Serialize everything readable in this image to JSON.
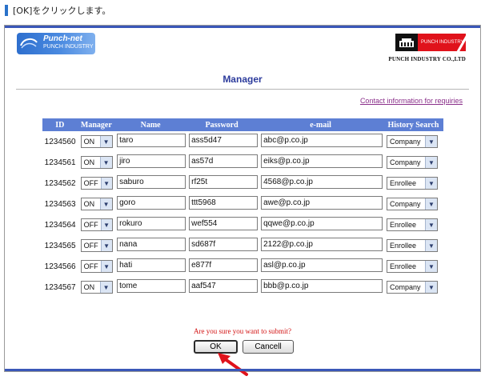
{
  "instruction": {
    "text": "[OK]をクリックします。"
  },
  "header": {
    "logo_name": "Punch-net",
    "logo_sub": "PUNCH INDUSTRY",
    "brand_badge": "PUNCH INDUSTRY",
    "company": "PUNCH INDUSTRY CO.,LTD",
    "title": "Manager"
  },
  "contact_link": "Contact information for requiries",
  "table": {
    "columns": [
      "ID",
      "Manager",
      "Name",
      "Password",
      "e-mail",
      "History Search"
    ],
    "rows": [
      {
        "id": "1234560",
        "manager": "ON",
        "name": "taro",
        "password": "ass5d47",
        "email": "abc@p.co.jp",
        "history": "Company"
      },
      {
        "id": "1234561",
        "manager": "ON",
        "name": "jiro",
        "password": "as57d",
        "email": "eiks@p.co.jp",
        "history": "Company"
      },
      {
        "id": "1234562",
        "manager": "OFF",
        "name": "saburo",
        "password": "rf25t",
        "email": "4568@p.co.jp",
        "history": "Enrollee"
      },
      {
        "id": "1234563",
        "manager": "ON",
        "name": "goro",
        "password": "ttt5968",
        "email": "awe@p.co.jp",
        "history": "Company"
      },
      {
        "id": "1234564",
        "manager": "OFF",
        "name": "rokuro",
        "password": "wef554",
        "email": "qqwe@p.co.jp",
        "history": "Enrollee"
      },
      {
        "id": "1234565",
        "manager": "OFF",
        "name": "nana",
        "password": "sd687f",
        "email": "2122@p.co.jp",
        "history": "Enrollee"
      },
      {
        "id": "1234566",
        "manager": "OFF",
        "name": "hati",
        "password": "e877f",
        "email": "asl@p.co.jp",
        "history": "Enrollee"
      },
      {
        "id": "1234567",
        "manager": "ON",
        "name": "tome",
        "password": "aaf547",
        "email": "bbb@p.co.jp",
        "history": "Company"
      }
    ]
  },
  "confirm_text": "Are you sure you want to submit?",
  "buttons": {
    "ok": "OK",
    "cancel": "Cancell"
  },
  "colors": {
    "accent_blue": "#2c3b9c",
    "header_blue": "#5d7fd4",
    "confirm_red": "#d31414",
    "link_purple": "#8a2f8a",
    "pointer_red": "#e0121b"
  },
  "icons": {
    "dropdown": "chevron-down-icon",
    "pointer": "arrow-pointer-icon",
    "marker": "bar-marker-icon"
  }
}
